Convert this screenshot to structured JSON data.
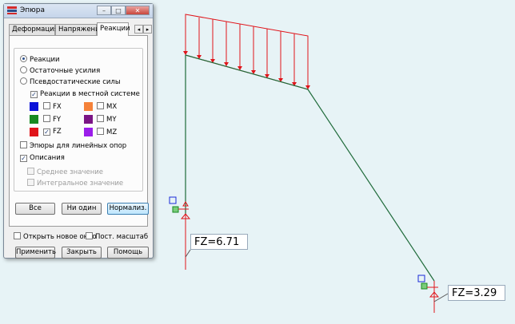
{
  "window": {
    "title": "Эпюра",
    "close_glyph": "✕",
    "min_glyph": "–",
    "max_glyph": "□"
  },
  "tabs": [
    {
      "label": "Деформация"
    },
    {
      "label": "Напряжение"
    },
    {
      "label": "Реакции",
      "selected": true
    }
  ],
  "tab_nav": {
    "left": "◂",
    "right": "▸"
  },
  "result_type": {
    "options": [
      {
        "label": "Реакции",
        "selected": true
      },
      {
        "label": "Остаточные усилия",
        "selected": false
      },
      {
        "label": "Псевдостатические силы",
        "selected": false
      }
    ]
  },
  "local_system": {
    "label": "Реакции в местной системе",
    "checked": true
  },
  "components": [
    {
      "label": "FX",
      "color": "#0a12d8",
      "checked": false
    },
    {
      "label": "MX",
      "color": "#f5823a",
      "checked": false
    },
    {
      "label": "FY",
      "color": "#178a21",
      "checked": false
    },
    {
      "label": "MY",
      "color": "#7b1585",
      "checked": false
    },
    {
      "label": "FZ",
      "color": "#e0141a",
      "checked": true
    },
    {
      "label": "MZ",
      "color": "#9b1dea",
      "checked": false
    }
  ],
  "options": {
    "linear_supports": {
      "label": "Эпюры для линейных опор",
      "checked": false
    },
    "descriptions": {
      "label": "Описания",
      "checked": true
    },
    "mean_value": {
      "label": "Среднее значение",
      "checked": false
    },
    "integral_value": {
      "label": "Интегральное значение",
      "checked": false
    }
  },
  "buttons": {
    "all": "Все",
    "none": "Ни один",
    "normalize": "Нормализ.",
    "apply": "Применить",
    "close": "Закрыть",
    "help": "Помощь"
  },
  "bottom": {
    "new_window": {
      "label": "Открыть новое окно",
      "checked": false
    },
    "fixed_scale": {
      "label": "Пост. масштаб",
      "checked": false
    }
  },
  "model": {
    "reactions": [
      {
        "text": "FZ=6.71"
      },
      {
        "text": "FZ=3.29"
      }
    ],
    "colors": {
      "frame": "#1f6b3a",
      "load": "#e0141a",
      "pointer": "#d42a2a"
    }
  }
}
